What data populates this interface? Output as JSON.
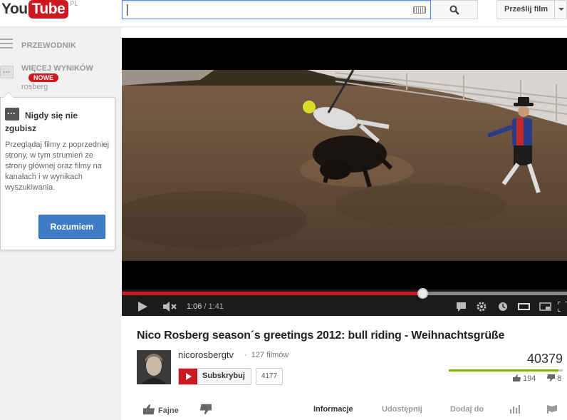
{
  "header": {
    "logo_you": "You",
    "logo_tube": "Tube",
    "logo_country": "PL",
    "search": {
      "value": "",
      "placeholder": ""
    },
    "upload_label": "Prześlij film"
  },
  "sidebar": {
    "guide_label": "PRZEWODNIK",
    "more_results_label": "WIĘCEJ WYNIKÓW",
    "new_badge": "NOWE",
    "more_results_query": "rosberg",
    "tooltip": {
      "title": "Nigdy się nie zgubisz",
      "body": "Przeglądaj filmy z poprzedniej strony, w tym strumień ze strony głównej oraz filmy na kanałach i w wynikach wyszukiwania.",
      "button": "Rozumiem"
    }
  },
  "player": {
    "current_time": "1:06",
    "duration": "1:41",
    "played_fraction": 0.675,
    "buffered_fraction": 1.0
  },
  "video": {
    "title": "Nico Rosberg season´s greetings 2012: bull riding - Weihnachtsgrüße",
    "channel_name": "nicorosbergtv",
    "video_count": "127 filmów",
    "subscribe_label": "Subskrybuj",
    "subscriber_count": "4177",
    "views": "40379",
    "likes": "194",
    "dislikes": "8",
    "like_ratio": 0.96
  },
  "actions": {
    "like_label": "Fajne",
    "tabs": [
      "Informacje",
      "Udostępnij",
      "Dodaj do"
    ]
  },
  "colors": {
    "brand_red": "#cc181e",
    "accent_blue": "#3f7cc6",
    "like_green": "#7db700"
  }
}
